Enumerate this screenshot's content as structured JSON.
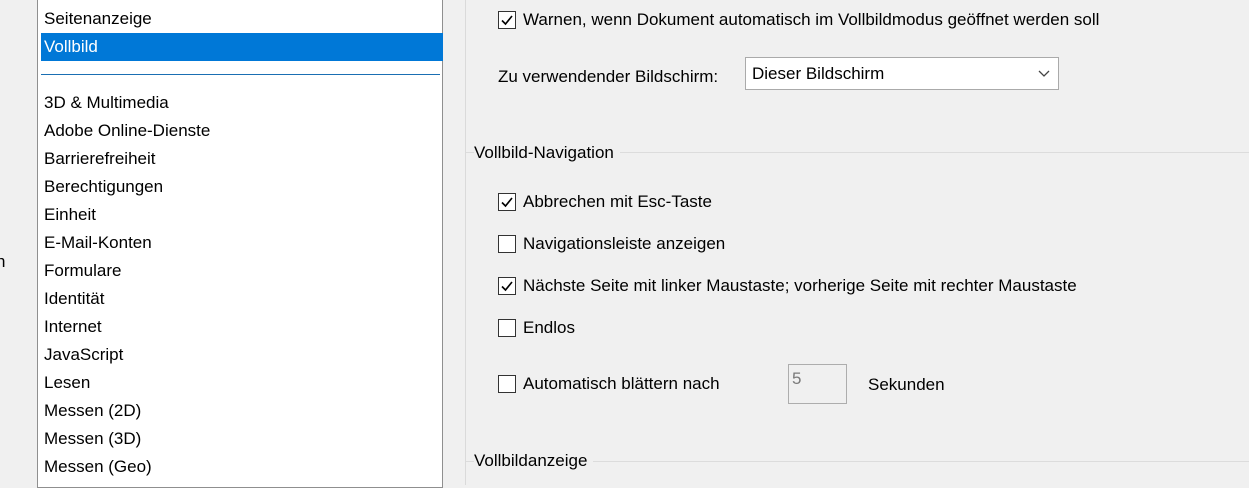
{
  "left_fragment": {
    "text": "n"
  },
  "category_list": {
    "items_top": [
      {
        "label": "Seitenanzeige",
        "selected": false
      },
      {
        "label": "Vollbild",
        "selected": true
      }
    ],
    "items": [
      "3D & Multimedia",
      "Adobe Online-Dienste",
      "Barrierefreiheit",
      "Berechtigungen",
      "Einheit",
      "E-Mail-Konten",
      "Formulare",
      "Identität",
      "Internet",
      "JavaScript",
      "Lesen",
      "Messen (2D)",
      "Messen (3D)",
      "Messen (Geo)"
    ]
  },
  "setup": {
    "warn_label": "Warnen, wenn Dokument automatisch im Vollbildmodus geöffnet werden soll",
    "warn_checked": true,
    "screen_label": "Zu verwendender Bildschirm:",
    "screen_value": "Dieser Bildschirm"
  },
  "navigation": {
    "title": "Vollbild-Navigation",
    "options": [
      {
        "label": "Abbrechen mit Esc-Taste",
        "checked": true
      },
      {
        "label": "Navigationsleiste anzeigen",
        "checked": false
      },
      {
        "label": "Nächste Seite mit linker Maustaste; vorherige Seite mit rechter Maustaste",
        "checked": true
      },
      {
        "label": "Endlos",
        "checked": false
      }
    ],
    "autoflip_label": "Automatisch blättern nach",
    "autoflip_checked": false,
    "autoflip_value": "5",
    "autoflip_unit": "Sekunden"
  },
  "display": {
    "title": "Vollbildanzeige"
  },
  "colors": {
    "selection": "#0078d7",
    "background": "#f0f0f0"
  }
}
